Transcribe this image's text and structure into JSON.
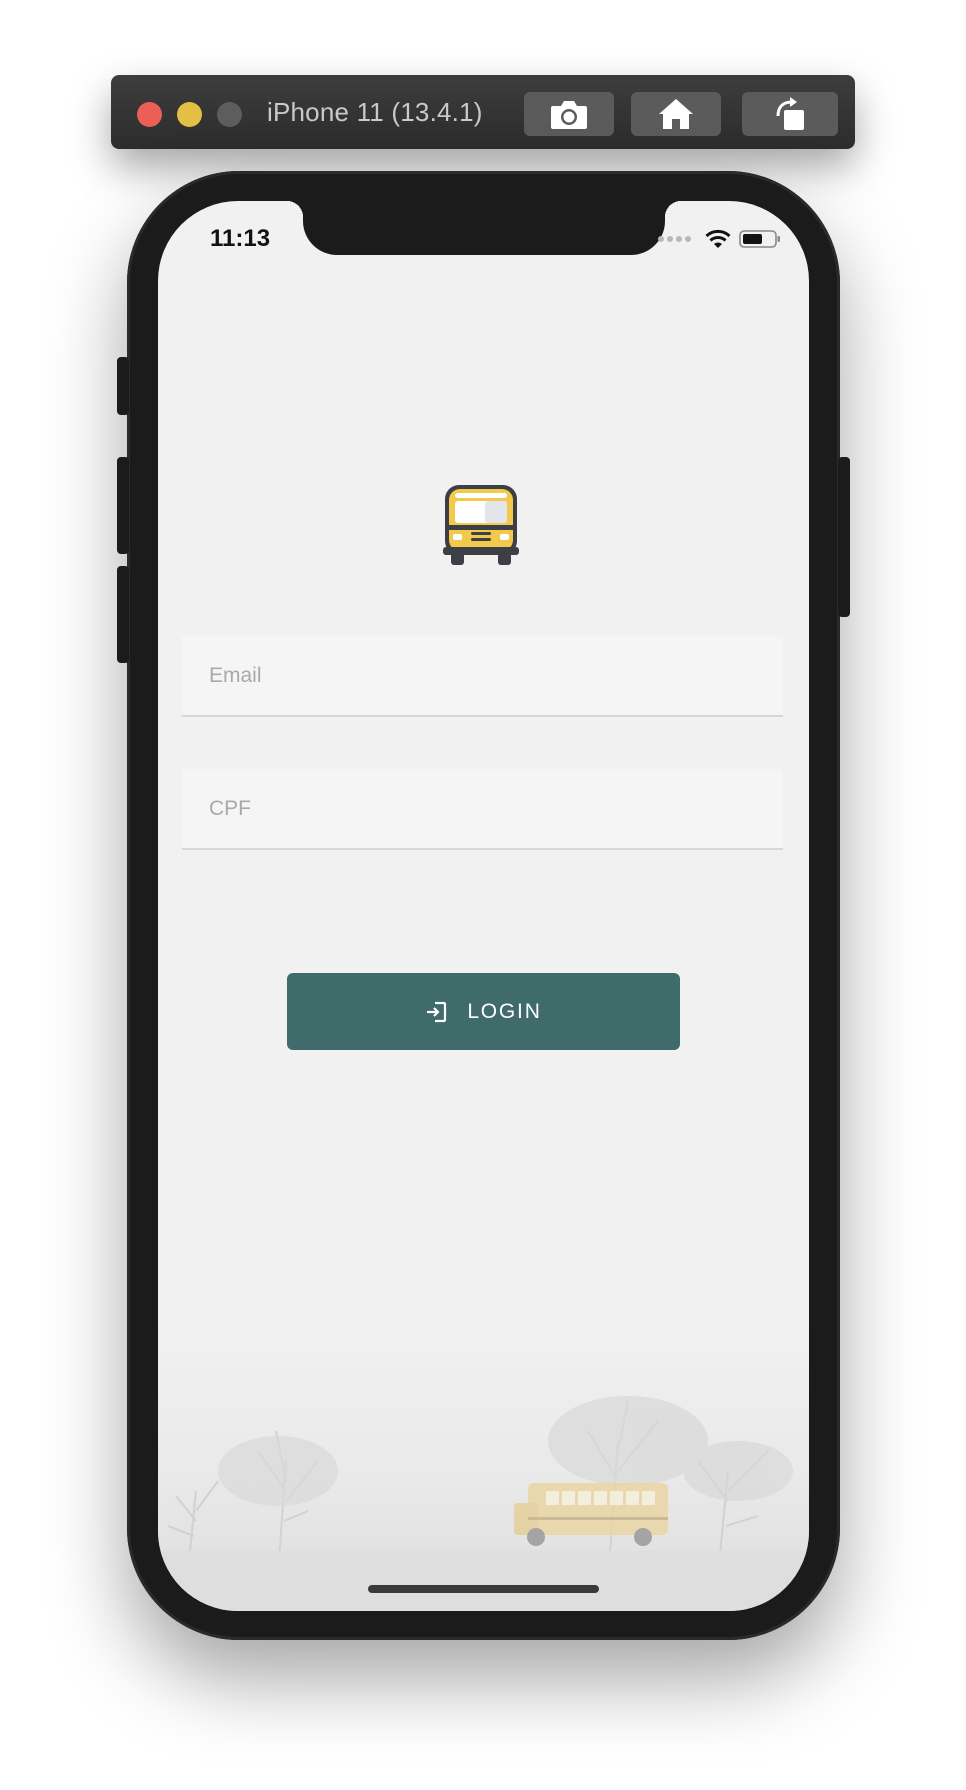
{
  "simulator": {
    "title": "iPhone 11 (13.4.1)",
    "buttons": {
      "screenshot_icon": "camera-icon",
      "home_icon": "home-icon",
      "rotate_icon": "rotate-icon"
    }
  },
  "status_bar": {
    "time": "11:13",
    "icons": [
      "cellular-dots-icon",
      "wifi-icon",
      "battery-icon"
    ]
  },
  "app": {
    "logo_icon": "school-bus-icon",
    "email_placeholder": "Email",
    "email_value": "",
    "cpf_placeholder": "CPF",
    "cpf_value": "",
    "login_label": "LOGIN",
    "login_icon": "login-icon",
    "background_image": "foggy-landscape-school-bus"
  },
  "colors": {
    "screen_background": "#f1f1f1",
    "login_button": "#3f6c6b",
    "bus_yellow": "#f2c94c",
    "bus_dark": "#3d3f46"
  }
}
